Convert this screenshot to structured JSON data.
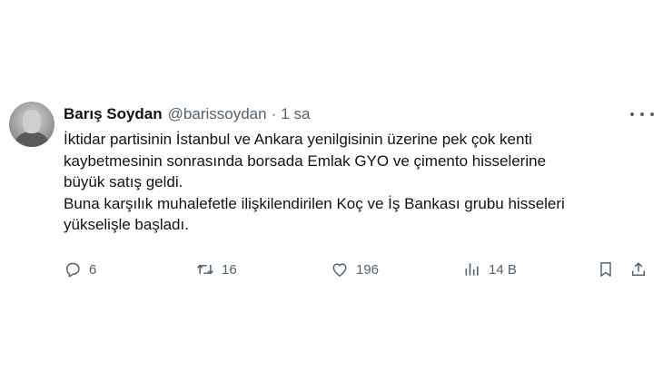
{
  "author": {
    "name": "Barış Soydan",
    "handle": "@barissoydan",
    "separator": "·",
    "time": "1 sa"
  },
  "post": {
    "lines": [
      "İktidar partisinin İstanbul ve Ankara yenilgisinin üzerine pek çok kenti",
      "kaybetmesinin sonrasında borsada Emlak GYO ve çimento hisselerine",
      "büyük satış geldi.",
      "Buna karşılık muhalefetle ilişkilendirilen Koç ve İş Bankası grubu hisseleri",
      "yükselişle başladı."
    ]
  },
  "actions": {
    "replies": "6",
    "reposts": "16",
    "likes": "196",
    "views": "14 B"
  },
  "icons": {
    "reply": "reply-icon",
    "repost": "repost-icon",
    "like": "like-icon",
    "views": "views-icon",
    "bookmark": "bookmark-icon",
    "share": "share-icon",
    "more": "more-icon"
  },
  "colors": {
    "text": "#0f1419",
    "secondary": "#536471",
    "background": "#ffffff"
  }
}
